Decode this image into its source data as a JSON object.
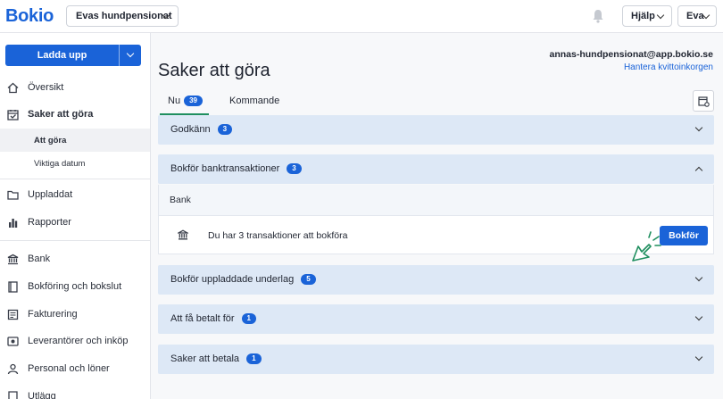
{
  "header": {
    "logo": "Bokio",
    "company": "Evas hundpensionat",
    "help_label": "Hjälp",
    "user_label": "Eva"
  },
  "sidebar": {
    "upload_label": "Ladda upp",
    "items": [
      {
        "label": "Översikt",
        "icon": "home-icon"
      },
      {
        "label": "Saker att göra",
        "icon": "calendar-check-icon"
      },
      {
        "label": "Att göra"
      },
      {
        "label": "Viktiga datum"
      },
      {
        "label": "Uppladdat",
        "icon": "folder-icon"
      },
      {
        "label": "Rapporter",
        "icon": "bar-chart-icon"
      },
      {
        "label": "Bank",
        "icon": "bank-icon"
      },
      {
        "label": "Bokföring och bokslut",
        "icon": "book-icon"
      },
      {
        "label": "Fakturering",
        "icon": "invoice-icon"
      },
      {
        "label": "Leverantörer och inköp",
        "icon": "supplier-icon"
      },
      {
        "label": "Personal och löner",
        "icon": "person-icon"
      },
      {
        "label": "Utlägg",
        "icon": "receipt-icon"
      }
    ]
  },
  "main": {
    "title": "Saker att göra",
    "email": "annas-hundpensionat@app.bokio.se",
    "inbox_link": "Hantera kvittoinkorgen",
    "tabs": [
      {
        "label": "Nu",
        "count": "39"
      },
      {
        "label": "Kommande"
      }
    ],
    "sections": [
      {
        "label": "Godkänn",
        "count": "3"
      },
      {
        "label": "Bokför banktransaktioner",
        "count": "3"
      },
      {
        "label": "Bokför uppladdade underlag",
        "count": "5"
      },
      {
        "label": "Att få betalt för",
        "count": "1"
      },
      {
        "label": "Saker att betala",
        "count": "1"
      }
    ],
    "bank_group_label": "Bank",
    "transaction_text": "Du har 3 transaktioner att bokföra",
    "bokfor_button": "Bokför"
  },
  "colors": {
    "accent": "#1a63d8",
    "section_bg": "#dde8f6",
    "tab_underline": "#1f8f5f",
    "cursor": "#1f8f5f"
  }
}
